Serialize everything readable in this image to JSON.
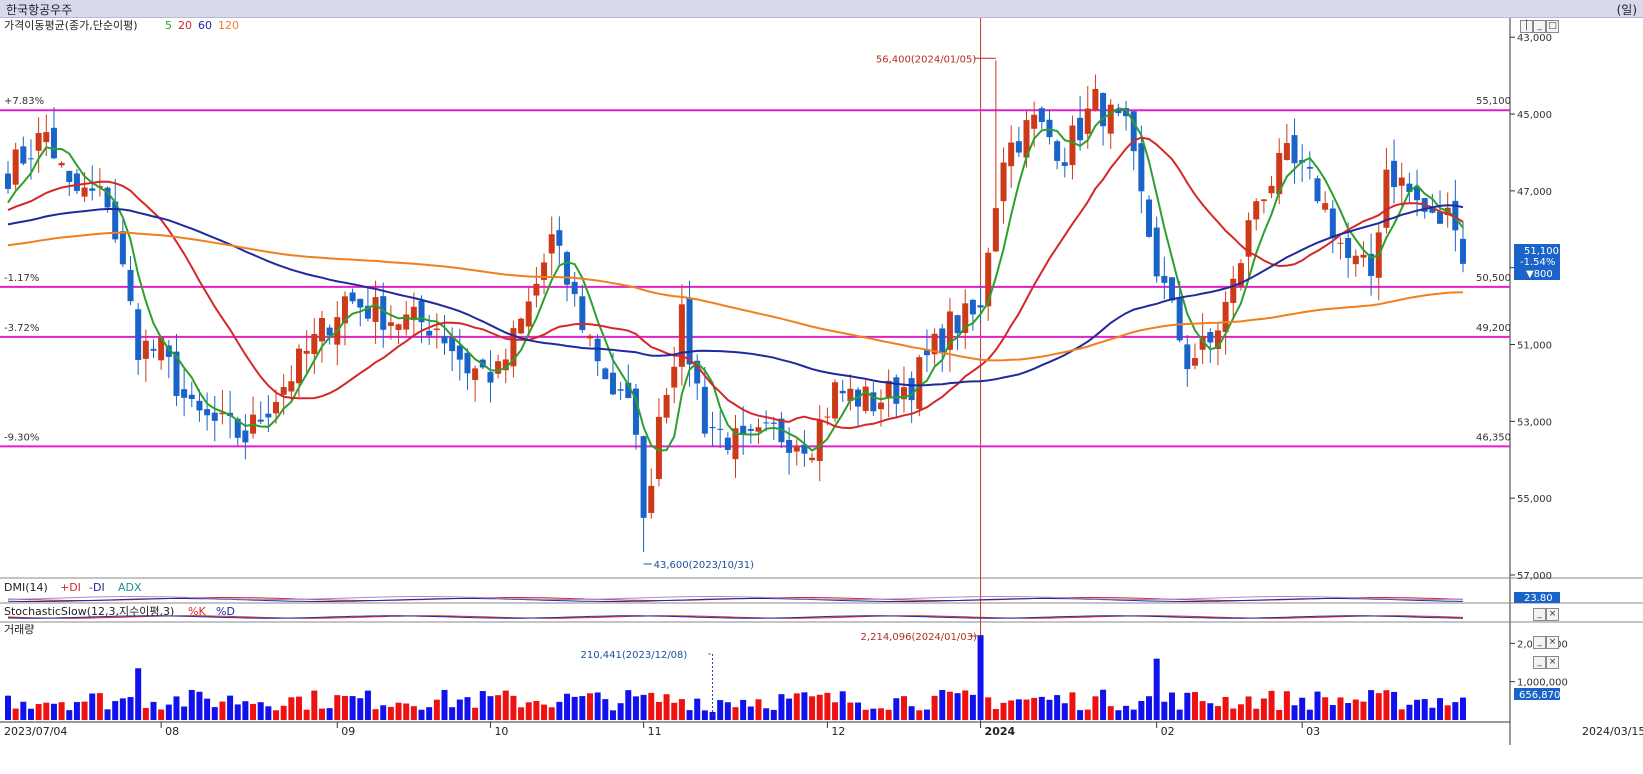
{
  "window": {
    "title": "한국항공우주",
    "unit_label": "(일)"
  },
  "panels": {
    "price": {
      "legend_name": "가격이동평균(종가,단순이평)",
      "ma_periods": [
        "5",
        "20",
        "60",
        "120"
      ],
      "ma_colors": [
        "#2ca02c",
        "#d62728",
        "#1f2a9c",
        "#f07f20"
      ]
    },
    "dmi": {
      "legend_name": "DMI(14)",
      "items": [
        "+DI",
        "-DI",
        "ADX"
      ],
      "value": "23.80"
    },
    "stochastic": {
      "legend_name": "StochasticSlow(12,3,지수이평,3)",
      "items": [
        "%K",
        "%D"
      ]
    },
    "volume": {
      "legend_name": "거래량",
      "value": "656,870",
      "annotations": {
        "max": "2,214,096(2024/01/03)",
        "mark": "210,441(2023/12/08)"
      },
      "y_ticks": [
        "2,000,000",
        "1,000,000"
      ]
    }
  },
  "price_axis": {
    "ticks": [
      "57,000",
      "55,000",
      "53,000",
      "51,000",
      "49,000",
      "47,000",
      "45,000",
      "43,000"
    ],
    "current": {
      "price": "51,100",
      "change_pct": "-1.54%",
      "change": "▼800"
    }
  },
  "levels": [
    {
      "pct": "+7.83%",
      "price": "55,100"
    },
    {
      "pct": "-1.17%",
      "price": "50,500"
    },
    {
      "pct": "-3.72%",
      "price": "49,200"
    },
    {
      "pct": "-9.30%",
      "price": "46,350"
    }
  ],
  "annotations": {
    "high": "56,400(2024/01/05)",
    "low": "43,600(2023/10/31)"
  },
  "x_axis": {
    "start": "2023/07/04",
    "end": "2024/03/15",
    "labels": [
      "08",
      "09",
      "10",
      "11",
      "12",
      "2024",
      "02",
      "03"
    ]
  },
  "chart_data": {
    "type": "candlestick",
    "ylim": [
      43000,
      57500
    ],
    "y_ticks": [
      43000,
      45000,
      47000,
      49000,
      51000,
      53000,
      55000,
      57000
    ],
    "horizontal_lines": [
      55100,
      50500,
      49200,
      46350
    ],
    "high_annotation": {
      "value": 56400,
      "date": "2024/01/05"
    },
    "low_annotation": {
      "value": 43600,
      "date": "2023/10/31"
    },
    "month_starts": [
      {
        "label": "08",
        "index": 20
      },
      {
        "label": "09",
        "index": 43
      },
      {
        "label": "10",
        "index": 63
      },
      {
        "label": "11",
        "index": 83
      },
      {
        "label": "12",
        "index": 107
      },
      {
        "label": "2024",
        "index": 127
      },
      {
        "label": "02",
        "index": 150
      },
      {
        "label": "03",
        "index": 169
      }
    ],
    "close_anchors": [
      [
        0,
        53500
      ],
      [
        5,
        54500
      ],
      [
        8,
        53000
      ],
      [
        13,
        52800
      ],
      [
        17,
        49000
      ],
      [
        20,
        48800
      ],
      [
        24,
        47200
      ],
      [
        31,
        46600
      ],
      [
        38,
        48500
      ],
      [
        44,
        50200
      ],
      [
        50,
        49700
      ],
      [
        56,
        49500
      ],
      [
        60,
        48400
      ],
      [
        64,
        48200
      ],
      [
        68,
        50000
      ],
      [
        71,
        51700
      ],
      [
        75,
        49600
      ],
      [
        79,
        47800
      ],
      [
        82,
        47000
      ],
      [
        83,
        44200
      ],
      [
        85,
        47200
      ],
      [
        88,
        49600
      ],
      [
        91,
        47000
      ],
      [
        96,
        46300
      ],
      [
        100,
        46700
      ],
      [
        105,
        46500
      ],
      [
        108,
        47800
      ],
      [
        113,
        47500
      ],
      [
        118,
        48000
      ],
      [
        123,
        49500
      ],
      [
        127,
        49800
      ],
      [
        128,
        51600
      ],
      [
        130,
        54000
      ],
      [
        134,
        54800
      ],
      [
        138,
        54000
      ],
      [
        142,
        55300
      ],
      [
        146,
        54500
      ],
      [
        150,
        51000
      ],
      [
        154,
        48600
      ],
      [
        157,
        49000
      ],
      [
        160,
        50500
      ],
      [
        163,
        52800
      ],
      [
        167,
        53800
      ],
      [
        171,
        53000
      ],
      [
        175,
        51200
      ],
      [
        178,
        50800
      ],
      [
        180,
        53600
      ],
      [
        182,
        53200
      ],
      [
        186,
        52200
      ],
      [
        189,
        52400
      ],
      [
        190,
        51100
      ]
    ],
    "volume_spikes": [
      {
        "index": 127,
        "value": 2214096
      },
      {
        "index": 150,
        "value": 1600000
      },
      {
        "index": 17,
        "value": 1350000
      },
      {
        "index": 92,
        "value": 210441
      }
    ]
  }
}
